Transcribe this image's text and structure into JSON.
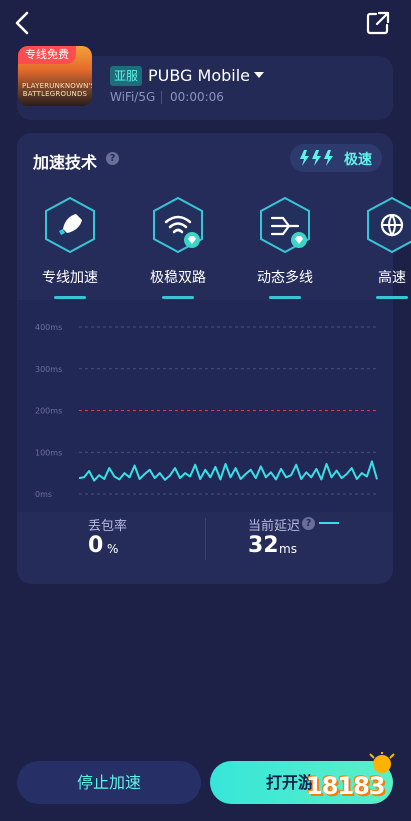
{
  "header": {
    "back_icon": "chevron-left-icon",
    "share_icon": "share-external-icon"
  },
  "game": {
    "free_badge": "专线免费",
    "art_title": "PLAYERUNKNOWN'S BATTLEGROUNDS",
    "region": "亚服",
    "name": "PUBG Mobile",
    "network": "WiFi/5G",
    "timer": "00:00:06"
  },
  "tech": {
    "title": "加速技术",
    "mode_label": "极速",
    "features": [
      {
        "label": "专线加速",
        "icon": "rocket-icon"
      },
      {
        "label": "极稳双路",
        "icon": "wifi-dual-icon"
      },
      {
        "label": "动态多线",
        "icon": "multiline-icon"
      },
      {
        "label": "高速",
        "icon": "globe-icon"
      }
    ]
  },
  "chart_data": {
    "type": "line",
    "title": "",
    "y_ticks": [
      "400ms",
      "300ms",
      "200ms",
      "100ms",
      "0ms"
    ],
    "ylim": [
      0,
      400
    ],
    "threshold": 200,
    "series": [
      {
        "values": [
          38,
          40,
          55,
          32,
          45,
          36,
          62,
          42,
          35,
          50,
          40,
          68,
          36,
          48,
          58,
          38,
          50,
          34,
          44,
          62,
          38,
          50,
          42,
          70,
          36,
          58,
          40,
          65,
          35,
          72,
          40,
          62,
          36,
          48,
          58,
          38,
          66,
          40,
          52,
          35,
          60,
          40,
          45,
          70,
          36,
          52,
          40,
          60,
          35,
          72,
          40,
          56,
          38,
          48,
          62,
          36,
          50,
          42,
          78,
          35
        ]
      }
    ],
    "colors": {
      "line": "#37e0e8",
      "grid": "#4a5180",
      "threshold": "#e03a4a"
    }
  },
  "stats": {
    "loss_label": "丢包率",
    "loss_value": "0",
    "loss_unit": "%",
    "latency_label": "当前延迟",
    "latency_value": "32",
    "latency_unit": "ms"
  },
  "actions": {
    "stop": "停止加速",
    "open": "打开游"
  },
  "watermark": {
    "text": "18183"
  }
}
